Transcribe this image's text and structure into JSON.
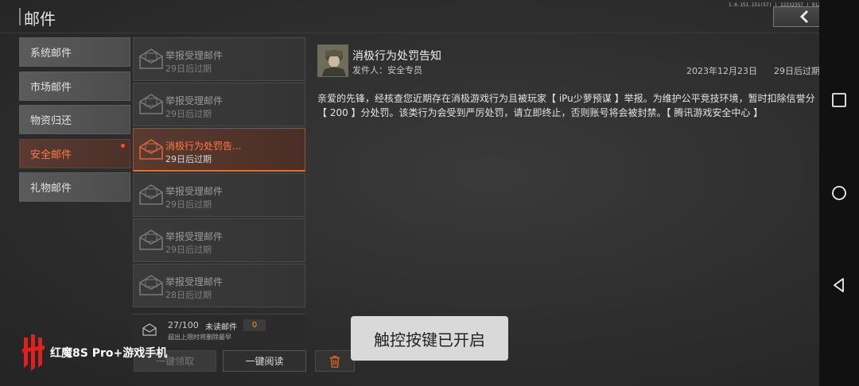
{
  "header": {
    "title": "邮件",
    "status_line": "1.0.151.151(57) | 12232357 | 91226770.7.2 | 流畅",
    "back_icon": "chevron-left-icon"
  },
  "categories": [
    {
      "label": "系统邮件",
      "active": false
    },
    {
      "label": "市场邮件",
      "active": false
    },
    {
      "label": "物资归还",
      "active": false
    },
    {
      "label": "安全邮件",
      "active": true,
      "has_dot": true
    },
    {
      "label": "礼物邮件",
      "active": false
    }
  ],
  "mails": [
    {
      "title": "举报受理邮件",
      "expiry": "29日后过期",
      "active": false
    },
    {
      "title": "举报受理邮件",
      "expiry": "29日后过期",
      "active": false
    },
    {
      "title": "消极行为处罚告...",
      "expiry": "29日后过期",
      "active": true
    },
    {
      "title": "举报受理邮件",
      "expiry": "29日后过期",
      "active": false
    },
    {
      "title": "举报受理邮件",
      "expiry": "29日后过期",
      "active": false
    },
    {
      "title": "举报受理邮件",
      "expiry": "28日后过期",
      "active": false
    }
  ],
  "summary": {
    "count": "27/100",
    "unread_label": "未读邮件",
    "unread_count": "0",
    "note": "超出上限时将删除最早"
  },
  "buttons": {
    "claim_all": "一键领取",
    "read_all": "一键阅读",
    "delete_icon": "trash-icon"
  },
  "detail": {
    "subject": "消极行为处罚告知",
    "sender": "发件人：安全专员",
    "date": "2023年12月23日",
    "expiry": "29日后过期",
    "body": "亲爱的先锋，经核查您近期存在消极游戏行为且被玩家【 iPu少萝预谋 】举报。为维护公平竞技环境，暂时扣除信誉分【 200 】分处罚。该类行为会受到严厉处罚，请立即终止，否则账号将会被封禁。【 腾讯游戏安全中心 】"
  },
  "toast": "触控按键已开启",
  "branding": "红魔8S Pro+游戏手机",
  "navbar": {
    "icons": [
      "square-icon",
      "circle-icon",
      "triangle-back-icon"
    ]
  },
  "colors": {
    "accent": "#ff7a45",
    "active_border": "#e86a2d",
    "unread_count": "#ff8a2a",
    "dot": "#ff4a2a"
  }
}
